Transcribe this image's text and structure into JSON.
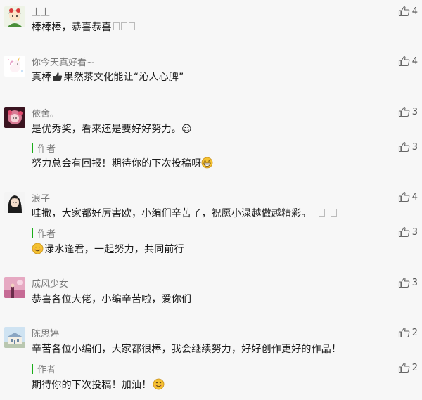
{
  "comments": [
    {
      "name": "土土",
      "text": "棒棒棒，恭喜恭喜",
      "likes": "4",
      "avatar_icon": "cartoon-girl-avatar"
    },
    {
      "name": "你今天真好看~",
      "text_before": "真棒",
      "text_after": "果然茶文化能让“沁人心脾”",
      "likes": "4",
      "avatar_icon": "unicorn-avatar"
    },
    {
      "name": "依舍。",
      "text": "是优秀奖，看来还是要好好努力。☺",
      "likes": "3",
      "avatar_icon": "pink-anime-avatar",
      "reply": {
        "author_label": "作者",
        "text": "努力总会有回报！期待你的下次投稿呀",
        "likes": "3"
      }
    },
    {
      "name": "浪子",
      "text": "哇撒，大家都好厉害欧，小编们辛苦了，祝愿小渌越做越精彩。",
      "likes": "4",
      "avatar_icon": "girl-portrait-avatar",
      "reply": {
        "author_label": "作者",
        "text": "渌水逢君，一起努力，共同前行",
        "likes": "3"
      }
    },
    {
      "name": "成风少女",
      "text": "恭喜各位大佬，小编辛苦啦，爱你们",
      "likes": "3",
      "avatar_icon": "pink-scene-avatar"
    },
    {
      "name": "陈思婷",
      "text": "辛苦各位小编们，大家都很棒，我会继续努力，好好创作更好的作品！",
      "likes": "2",
      "avatar_icon": "building-avatar",
      "reply": {
        "author_label": "作者",
        "text": "期待你的下次投稿！加油！",
        "likes": "2"
      }
    }
  ],
  "colors": {
    "background": "#f7f7f7",
    "author_bar": "#1aad19",
    "meta_text": "#7a7a7a"
  }
}
